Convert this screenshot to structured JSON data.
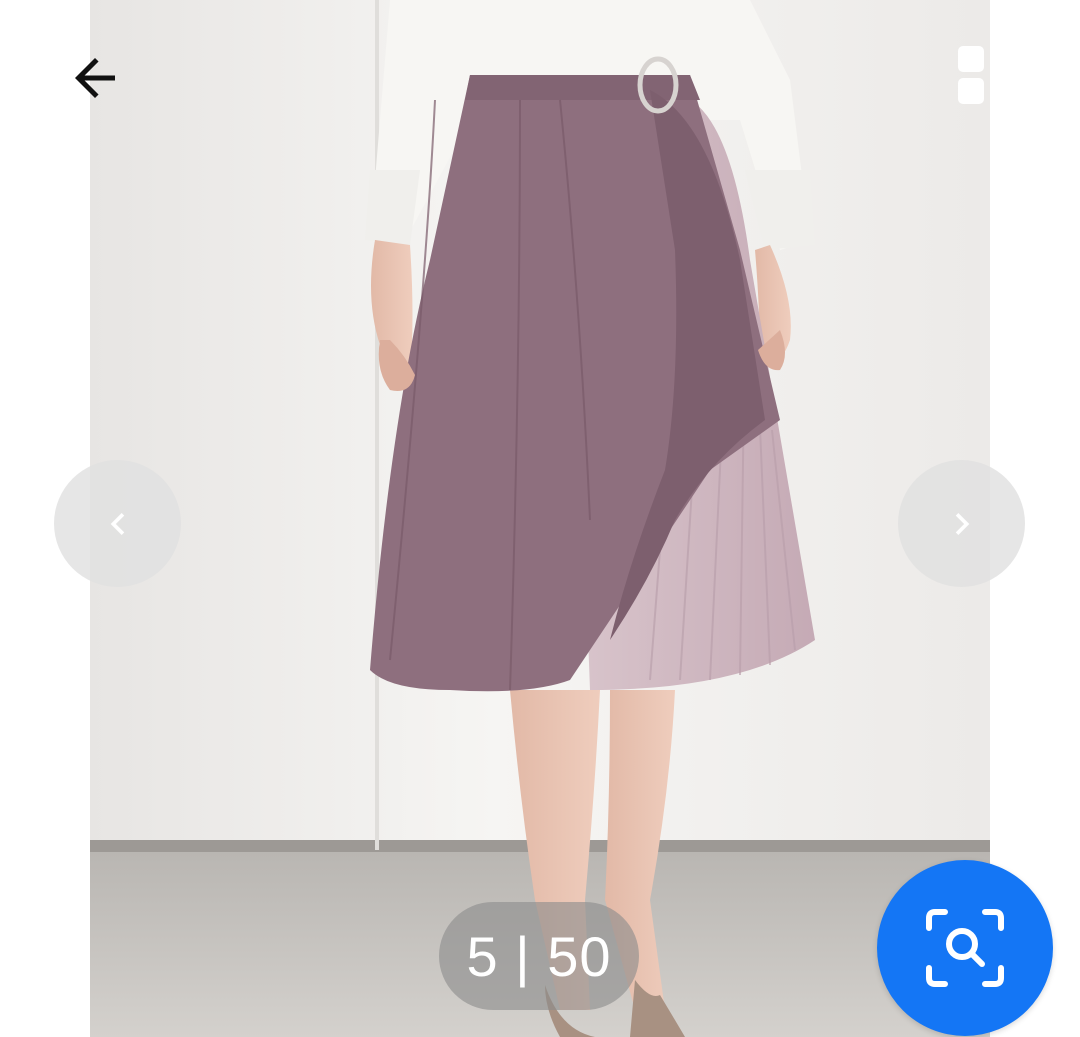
{
  "viewer": {
    "counter": {
      "current": "5",
      "separator": " | ",
      "total": "50"
    },
    "icons": {
      "back": "arrow-left-icon",
      "grid": "grid-icon",
      "prev": "chevron-left-icon",
      "next": "chevron-right-icon",
      "visual_search": "visual-search-icon"
    },
    "colors": {
      "accent": "#1476f5",
      "skirt_main": "#8e6f7e",
      "skirt_pleat": "#cdb6bf"
    }
  }
}
